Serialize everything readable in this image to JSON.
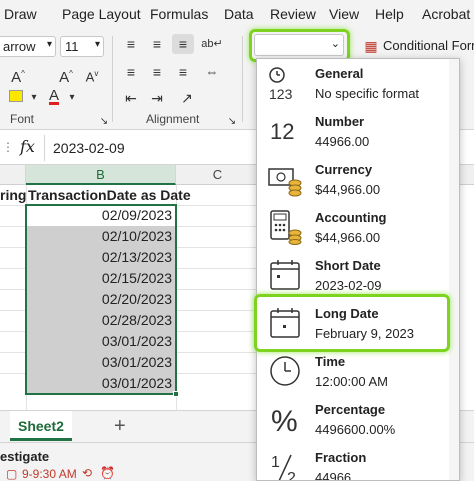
{
  "menu": [
    "Draw",
    "Page Layout",
    "Formulas",
    "Data",
    "Review",
    "View",
    "Help",
    "Acrobat"
  ],
  "ribbon": {
    "font_name": "arrow",
    "font_size": "11",
    "font_group_label": "Font",
    "alignment_group_label": "Alignment",
    "number_format_value": "",
    "conditional_formatting": "Conditional Form"
  },
  "formula_bar": {
    "fx_label": "fx",
    "value": "2023-02-09"
  },
  "columns": {
    "partial_a": "ring",
    "b": "B",
    "c": "C"
  },
  "sheet": {
    "header_partial": "ring",
    "header_b": "TransactionDate as Date",
    "dates": [
      "02/09/2023",
      "02/10/2023",
      "02/13/2023",
      "02/15/2023",
      "02/20/2023",
      "02/28/2023",
      "03/01/2023",
      "03/01/2023",
      "03/01/2023"
    ]
  },
  "tabs": {
    "active": "Sheet2",
    "add": "+"
  },
  "status": {
    "left": "estigate",
    "bottom": "9-9:30 AM"
  },
  "number_formats": [
    {
      "name": "General",
      "sample": "No specific format",
      "icon": "general-123-icon"
    },
    {
      "name": "Number",
      "sample": "44966.00",
      "icon": "number-12-icon"
    },
    {
      "name": "Currency",
      "sample": "$44,966.00",
      "icon": "currency-icon"
    },
    {
      "name": "Accounting",
      "sample": " $44,966.00",
      "icon": "accounting-icon"
    },
    {
      "name": "Short Date",
      "sample": "2023-02-09",
      "icon": "calendar-icon"
    },
    {
      "name": "Long Date",
      "sample": "February 9, 2023",
      "icon": "calendar-icon"
    },
    {
      "name": "Time",
      "sample": "12:00:00 AM",
      "icon": "clock-icon"
    },
    {
      "name": "Percentage",
      "sample": "4496600.00%",
      "icon": "percent-icon"
    },
    {
      "name": "Fraction",
      "sample": "44966",
      "icon": "fraction-icon"
    }
  ],
  "colors": {
    "highlight": "#7ed321",
    "selection_border": "#217346",
    "selection_fill": "#cfcfcf"
  }
}
